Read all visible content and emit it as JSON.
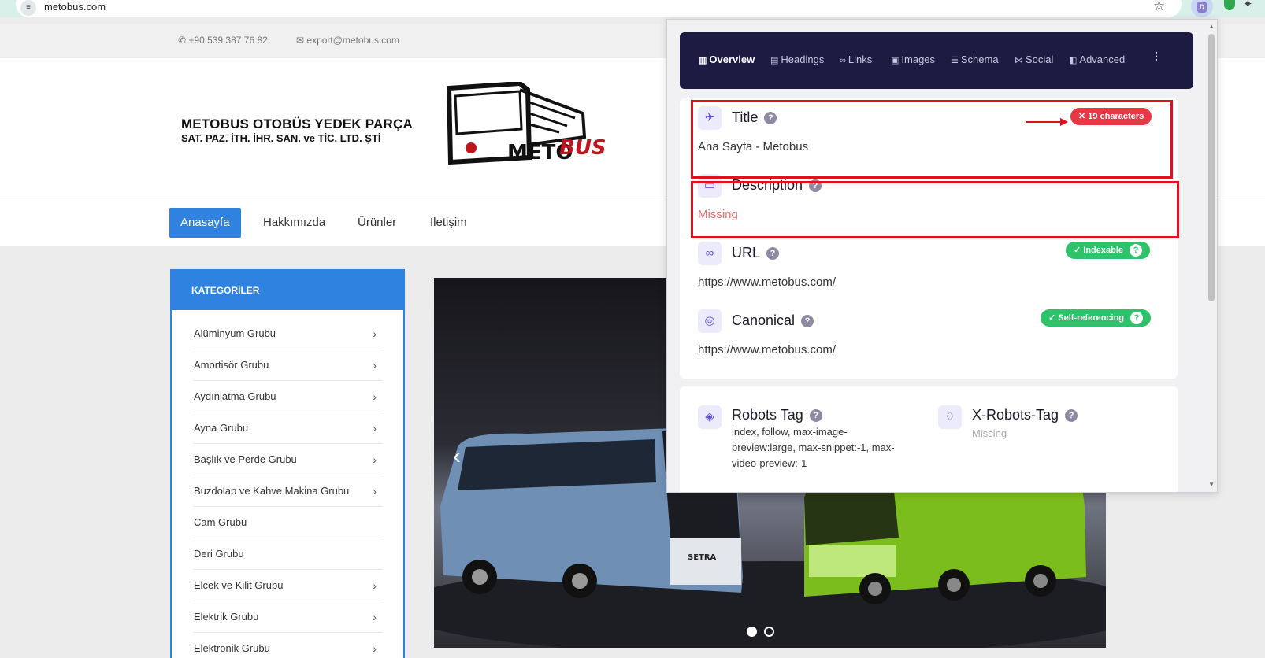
{
  "browser": {
    "url": "metobus.com",
    "site_settings_icon": "tune-icon",
    "bookmark_icon": "star-icon",
    "extension_letter": "D"
  },
  "site": {
    "phone": "+90 539 387 76 82",
    "email": "export@metobus.com",
    "company_line1": "METOBUS OTOBÜS YEDEK PARÇA",
    "company_line2": "SAT. PAZ. İTH. İHR. SAN. ve TİC. LTD. ŞTİ",
    "logo_text_a": "METO",
    "logo_text_b": "BUS",
    "nav": [
      "Anasayfa",
      "Hakkımızda",
      "Ürünler",
      "İletişim"
    ],
    "categories_title": "KATEGORİLER",
    "categories": [
      {
        "label": "Alüminyum Grubu",
        "chevron": true
      },
      {
        "label": "Amortisör Grubu",
        "chevron": true
      },
      {
        "label": "Aydınlatma Grubu",
        "chevron": true
      },
      {
        "label": "Ayna Grubu",
        "chevron": true
      },
      {
        "label": "Başlık ve Perde Grubu",
        "chevron": true
      },
      {
        "label": "Buzdolap ve Kahve Makina Grubu",
        "chevron": true
      },
      {
        "label": "Cam Grubu",
        "chevron": false
      },
      {
        "label": "Deri Grubu",
        "chevron": false
      },
      {
        "label": "Elcek ve Kilit Grubu",
        "chevron": true
      },
      {
        "label": "Elektrik Grubu",
        "chevron": true
      },
      {
        "label": "Elektronik Grubu",
        "chevron": true
      }
    ],
    "slider": {
      "prev_icon": "chevron-left-icon",
      "bus1_brand": "SETRA",
      "slides": 2,
      "active_slide": 1
    }
  },
  "seo_panel": {
    "tabs": [
      {
        "label": "Overview",
        "icon": "book-icon",
        "active": true
      },
      {
        "label": "Headings",
        "icon": "document-icon",
        "active": false
      },
      {
        "label": "Links",
        "icon": "link-icon",
        "active": false
      },
      {
        "label": "Images",
        "icon": "image-icon",
        "active": false
      },
      {
        "label": "Schema",
        "icon": "list-icon",
        "active": false
      },
      {
        "label": "Social",
        "icon": "share-icon",
        "active": false
      },
      {
        "label": "Advanced",
        "icon": "advanced-icon",
        "active": false
      }
    ],
    "settings_icon": "sliders-icon",
    "title": {
      "label": "Title",
      "value": "Ana Sayfa - Metobus",
      "badge": "19 characters"
    },
    "description": {
      "label": "Description",
      "value": "Missing"
    },
    "url": {
      "label": "URL",
      "value": "https://www.metobus.com/",
      "badge": "Indexable"
    },
    "canonical": {
      "label": "Canonical",
      "value": "https://www.metobus.com/",
      "badge": "Self-referencing"
    },
    "robots": {
      "label": "Robots Tag",
      "lines": [
        "index, follow, max-image-",
        "preview:large, max-snippet:-1, max-",
        "video-preview:-1"
      ]
    },
    "x_robots": {
      "label": "X-Robots-Tag",
      "value": "Missing"
    },
    "colors": {
      "accent": "#5b4fd6",
      "tabbar": "#1d1b42",
      "error": "#e53945",
      "ok": "#2ec36a",
      "annotation": "#e3111c"
    }
  }
}
